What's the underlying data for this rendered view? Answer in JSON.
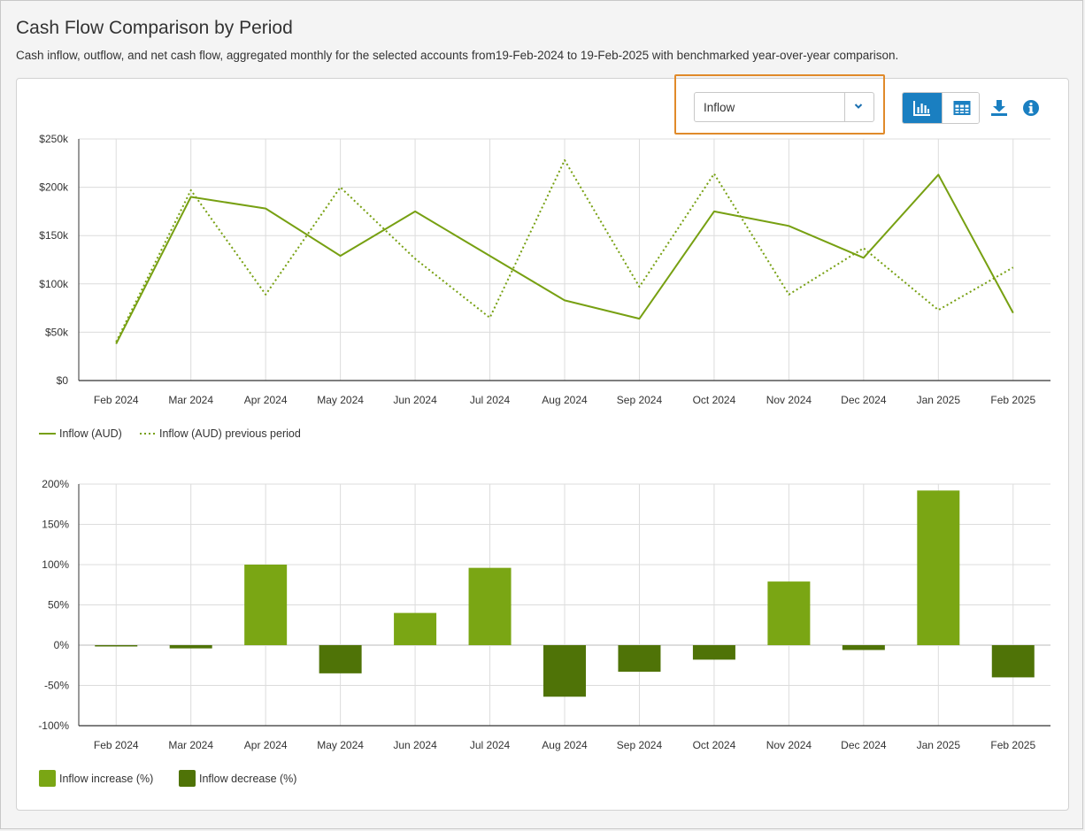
{
  "page": {
    "title": "Cash Flow Comparison by Period",
    "subtitle": "Cash inflow, outflow, and net cash flow, aggregated monthly for the selected accounts from19-Feb-2024 to 19-Feb-2025 with benchmarked year-over-year comparison."
  },
  "controls": {
    "metric_select_value": "Inflow",
    "chart_view_icon": "bar-chart-icon",
    "table_view_icon": "table-icon",
    "download_icon": "download-icon",
    "info_icon": "info-icon"
  },
  "colors": {
    "line": "#77a012",
    "increase": "#7aa614",
    "decrease": "#4f7307",
    "accent": "#1a7fc1",
    "highlight": "#e08a2a"
  },
  "chart_data": [
    {
      "type": "line",
      "categories": [
        "Feb 2024",
        "Mar 2024",
        "Apr 2024",
        "May 2024",
        "Jun 2024",
        "Jul 2024",
        "Aug 2024",
        "Sep 2024",
        "Oct 2024",
        "Nov 2024",
        "Dec 2024",
        "Jan 2025",
        "Feb 2025"
      ],
      "series": [
        {
          "name": "Inflow (AUD)",
          "style": "solid",
          "values": [
            38000,
            190000,
            178000,
            129000,
            175000,
            129000,
            83000,
            64000,
            175000,
            160000,
            127000,
            213000,
            70000
          ]
        },
        {
          "name": "Inflow (AUD) previous period",
          "style": "dotted",
          "values": [
            40000,
            197000,
            89000,
            200000,
            126000,
            65000,
            228000,
            97000,
            214000,
            89000,
            137000,
            73000,
            117000
          ]
        }
      ],
      "ylim": [
        0,
        250000
      ],
      "yticks": [
        0,
        50000,
        100000,
        150000,
        200000,
        250000
      ],
      "ytick_labels": [
        "$0",
        "$50k",
        "$100k",
        "$150k",
        "$200k",
        "$250k"
      ],
      "grid": true,
      "legend": "bottom-left"
    },
    {
      "type": "bar",
      "categories": [
        "Feb 2024",
        "Mar 2024",
        "Apr 2024",
        "May 2024",
        "Jun 2024",
        "Jul 2024",
        "Aug 2024",
        "Sep 2024",
        "Oct 2024",
        "Nov 2024",
        "Dec 2024",
        "Jan 2025",
        "Feb 2025"
      ],
      "values": [
        -1,
        -4,
        100,
        -35,
        40,
        96,
        -64,
        -33,
        -18,
        79,
        -6,
        192,
        -40
      ],
      "legend_entries": [
        "Inflow increase (%)",
        "Inflow decrease (%)"
      ],
      "ylim": [
        -100,
        200
      ],
      "yticks": [
        -100,
        -50,
        0,
        50,
        100,
        150,
        200
      ],
      "ytick_labels": [
        "-100%",
        "-50%",
        "0%",
        "50%",
        "100%",
        "150%",
        "200%"
      ],
      "grid": true,
      "legend": "bottom-left"
    }
  ]
}
